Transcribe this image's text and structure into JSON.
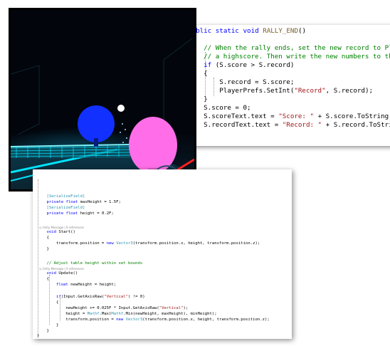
{
  "top_code": {
    "lines": [
      [
        {
          "t": "public",
          "c": "kw"
        },
        {
          "t": " "
        },
        {
          "t": "static",
          "c": "kw"
        },
        {
          "t": " "
        },
        {
          "t": "void",
          "c": "kw"
        },
        {
          "t": " "
        },
        {
          "t": "RALLY_END",
          "c": "fn"
        },
        {
          "t": "()"
        }
      ],
      [
        {
          "t": "{"
        }
      ],
      [
        {
          "t": "    "
        },
        {
          "t": "// When the rally ends, set the new record to Player",
          "c": "cm"
        }
      ],
      [
        {
          "t": "    "
        },
        {
          "t": "// a highscore. Then write the new numbers to the UI",
          "c": "cm"
        }
      ],
      [
        {
          "t": "    "
        },
        {
          "t": "if",
          "c": "kw"
        },
        {
          "t": " (S.score > S.record)"
        }
      ],
      [
        {
          "t": "    {"
        }
      ],
      [
        {
          "t": "        S.record = S.score;"
        }
      ],
      [
        {
          "t": "        PlayerPrefs.SetInt("
        },
        {
          "t": "\"Record\"",
          "c": "st"
        },
        {
          "t": ", S.record);"
        }
      ],
      [
        {
          "t": "    }"
        }
      ],
      [
        {
          "t": "    S.score = 0;"
        }
      ],
      [
        {
          "t": "    S.scoreText.text = "
        },
        {
          "t": "\"Score: \"",
          "c": "st"
        },
        {
          "t": " + S.score.ToString();"
        }
      ],
      [
        {
          "t": "    S.recordText.text = "
        },
        {
          "t": "\"Record: \"",
          "c": "st"
        },
        {
          "t": " + S.record.ToString"
        }
      ]
    ]
  },
  "bottom_code": {
    "lines": [
      [
        {
          "t": "    [SerializeField]",
          "c": "at"
        }
      ],
      [
        {
          "t": "    "
        },
        {
          "t": "private",
          "c": "kw"
        },
        {
          "t": " "
        },
        {
          "t": "float",
          "c": "kw"
        },
        {
          "t": " maxHeight = 1.5F;"
        }
      ],
      [
        {
          "t": "    [SerializeField]",
          "c": "at"
        }
      ],
      [
        {
          "t": "    "
        },
        {
          "t": "private",
          "c": "kw"
        },
        {
          "t": " "
        },
        {
          "t": "float",
          "c": "kw"
        },
        {
          "t": " height = 0.2F;"
        }
      ],
      [
        {
          "t": ""
        }
      ],
      [
        {
          "t": "    "
        },
        {
          "t": "void",
          "c": "kw"
        },
        {
          "t": " Start()"
        }
      ],
      [
        {
          "t": "    {"
        }
      ],
      [
        {
          "t": "        transform.position = "
        },
        {
          "t": "new",
          "c": "kw"
        },
        {
          "t": " "
        },
        {
          "t": "Vector3",
          "c": "ty"
        },
        {
          "t": "(transform.position.x, height, transform.position.z);"
        }
      ],
      [
        {
          "t": "    }"
        }
      ],
      [
        {
          "t": ""
        }
      ],
      [
        {
          "t": "    "
        },
        {
          "t": "// Adjust table height within set bounds",
          "c": "cm"
        }
      ],
      [
        {
          "t": "    "
        },
        {
          "t": "void",
          "c": "kw"
        },
        {
          "t": " Update()"
        }
      ],
      [
        {
          "t": "    {"
        }
      ],
      [
        {
          "t": "        "
        },
        {
          "t": "float",
          "c": "kw"
        },
        {
          "t": " newHeight = height;"
        }
      ],
      [
        {
          "t": ""
        }
      ],
      [
        {
          "t": "        "
        },
        {
          "t": "if",
          "c": "kw"
        },
        {
          "t": "(Input.GetAxisRaw("
        },
        {
          "t": "\"Vertical\"",
          "c": "st"
        },
        {
          "t": ") != 0)"
        }
      ],
      [
        {
          "t": "        {"
        }
      ],
      [
        {
          "t": "            newHeight += 0.025F * Input.GetAxisRaw("
        },
        {
          "t": "\"Vertical\"",
          "c": "st"
        },
        {
          "t": ");"
        }
      ],
      [
        {
          "t": "            height = "
        },
        {
          "t": "Mathf",
          "c": "ty"
        },
        {
          "t": ".Max("
        },
        {
          "t": "Mathf",
          "c": "ty"
        },
        {
          "t": ".Min(newHeight, maxHeight), minHeight);"
        }
      ],
      [
        {
          "t": "            transform.position = "
        },
        {
          "t": "new",
          "c": "kw"
        },
        {
          "t": " "
        },
        {
          "t": "Vector3",
          "c": "ty"
        },
        {
          "t": "(transform.position.x, height, transform.position.z);"
        }
      ],
      [
        {
          "t": "        }"
        }
      ],
      [
        {
          "t": "    }"
        }
      ],
      [
        {
          "t": "}"
        }
      ]
    ],
    "codelens": "◎ Unity Message | 0 references"
  },
  "scene": {
    "sky": "#02050c",
    "net_color": "#00e5ff",
    "paddle_blue": "#1230ff",
    "paddle_pink": "#ff6ee8",
    "laser": "#ff2020",
    "ball": "#ffffff"
  }
}
